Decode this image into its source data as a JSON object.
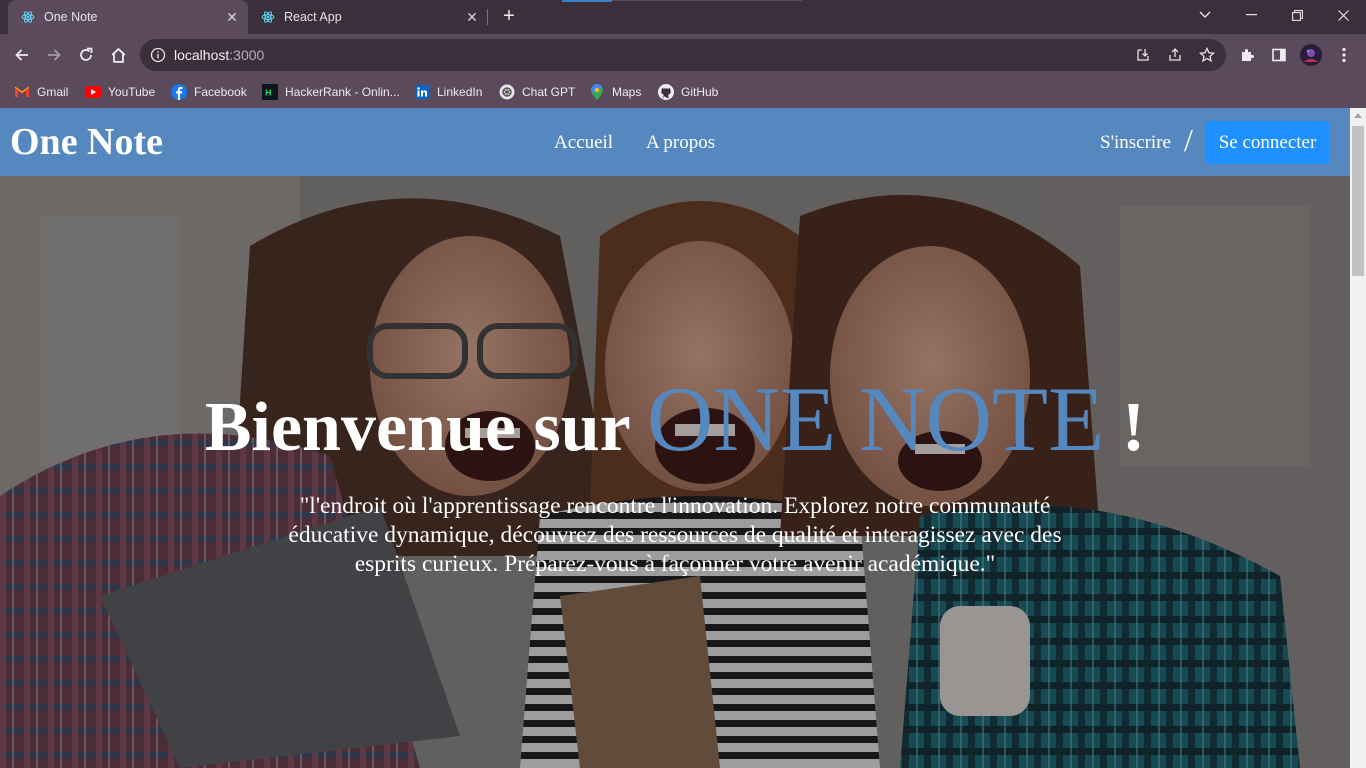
{
  "browser": {
    "tabs": [
      {
        "label": "One Note",
        "active": true,
        "icon": "react-icon"
      },
      {
        "label": "React App",
        "active": false,
        "icon": "react-icon"
      }
    ],
    "address": {
      "host": "localhost",
      "port": ":3000"
    },
    "bookmarks": [
      {
        "label": "Gmail",
        "icon": "gmail-icon"
      },
      {
        "label": "YouTube",
        "icon": "youtube-icon"
      },
      {
        "label": "Facebook",
        "icon": "facebook-icon"
      },
      {
        "label": "HackerRank - Onlin...",
        "icon": "hackerrank-icon"
      },
      {
        "label": "LinkedIn",
        "icon": "linkedin-icon"
      },
      {
        "label": "Chat GPT",
        "icon": "chatgpt-icon"
      },
      {
        "label": "Maps",
        "icon": "maps-icon"
      },
      {
        "label": "GitHub",
        "icon": "github-icon"
      }
    ]
  },
  "site": {
    "brand": "One Note",
    "nav": {
      "home": "Accueil",
      "about": "A propos"
    },
    "auth": {
      "signup": "S'inscrire",
      "separator": "/",
      "login": "Se connecter"
    },
    "hero": {
      "title_prefix": "Bienvenue sur",
      "title_accent": "ONE NOTE",
      "title_suffix": "!",
      "subtitle": "\"l'endroit où l'apprentissage rencontre l'innovation. Explorez notre communauté éducative dynamique, découvrez des ressources de qualité et interagissez avec des esprits curieux. Préparez-vous à façonner votre avenir académique.\""
    }
  },
  "colors": {
    "navbar": "#5688c0",
    "accent": "#5688c0",
    "login_button": "#1e90ff",
    "chrome_frame": "#3b2f3c",
    "chrome_toolbar": "#5a4a5c"
  }
}
